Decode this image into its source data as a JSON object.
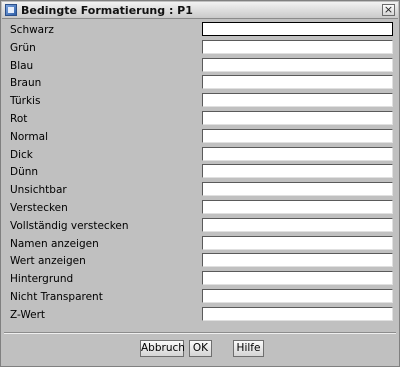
{
  "window": {
    "title": "Bedingte Formatierung : P1",
    "close_glyph": "×"
  },
  "fields": [
    {
      "label": "Schwarz",
      "value": ""
    },
    {
      "label": "Grün",
      "value": ""
    },
    {
      "label": "Blau",
      "value": ""
    },
    {
      "label": "Braun",
      "value": ""
    },
    {
      "label": "Türkis",
      "value": ""
    },
    {
      "label": "Rot",
      "value": ""
    },
    {
      "label": "Normal",
      "value": ""
    },
    {
      "label": "Dick",
      "value": ""
    },
    {
      "label": "Dünn",
      "value": ""
    },
    {
      "label": "Unsichtbar",
      "value": ""
    },
    {
      "label": "Verstecken",
      "value": ""
    },
    {
      "label": "Vollständig verstecken",
      "value": ""
    },
    {
      "label": "Namen anzeigen",
      "value": ""
    },
    {
      "label": "Wert anzeigen",
      "value": ""
    },
    {
      "label": "Hintergrund",
      "value": ""
    },
    {
      "label": "Nicht Transparent",
      "value": ""
    },
    {
      "label": "Z-Wert",
      "value": ""
    }
  ],
  "buttons": {
    "cancel": "Abbruch",
    "ok": "OK",
    "help": "Hilfe"
  }
}
